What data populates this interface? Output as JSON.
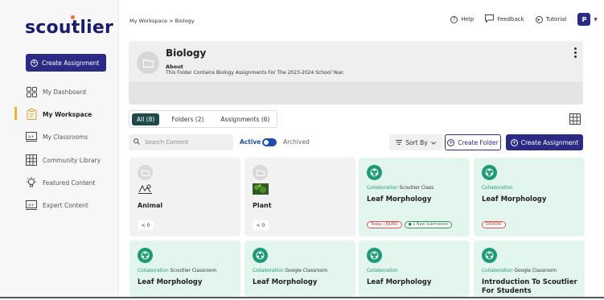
{
  "app": {
    "logo": "scoutlier",
    "create_assignment": "Create Assignment"
  },
  "sidebar": {
    "items": [
      {
        "label": "My Dashboard",
        "icon": "dashboard-icon"
      },
      {
        "label": "My Workspace",
        "icon": "clipboard-icon",
        "active": true
      },
      {
        "label": "My Classrooms",
        "icon": "classroom-icon"
      },
      {
        "label": "Community Library",
        "icon": "library-icon"
      },
      {
        "label": "Featured Content",
        "icon": "bulb-icon"
      },
      {
        "label": "Expert Content",
        "icon": "expert-icon"
      }
    ]
  },
  "header": {
    "breadcrumb": "My Workspace > Biology",
    "help": "Help",
    "feedback": "Feedback",
    "tutorial": "Tutorial",
    "avatar": "P"
  },
  "folder": {
    "title": "Biology",
    "about_label": "About",
    "description": "This Folder Contains Biology Assignments For The 2023-2024 School Year."
  },
  "tabs": [
    {
      "label": "All (8)",
      "selected": true
    },
    {
      "label": "Folders (2)"
    },
    {
      "label": "Assignments (6)"
    }
  ],
  "toolbar": {
    "search_placeholder": "Search Content",
    "active_label": "Active",
    "archived_label": "Archived",
    "sort_label": "Sort By",
    "create_folder": "Create Folder",
    "create_assignment": "Create Assignment"
  },
  "cards": [
    {
      "type": "folder",
      "title": "Animal",
      "share_count": "< 0"
    },
    {
      "type": "folder",
      "title": "Plant",
      "share_count": "< 0"
    },
    {
      "type": "assignment",
      "tag": "Collaboration",
      "source": "Scoutlier Class",
      "title": "Leaf Morphology",
      "pills": [
        {
          "text": "Today | EJURQ",
          "color": "red"
        },
        {
          "text": "● 1 New Submission",
          "color": "green"
        }
      ]
    },
    {
      "type": "assignment",
      "tag": "Collaboration",
      "source": "",
      "title": "Leaf Morphology",
      "pills": [
        {
          "text": "DE9IDW",
          "color": "red"
        }
      ]
    },
    {
      "type": "assignment",
      "tag": "Collaboration",
      "source": "Scoutlier Classroom",
      "title": "Leaf Morphology",
      "pills": []
    },
    {
      "type": "assignment",
      "tag": "Collaboration",
      "source": "Google Classroom",
      "title": "Leaf Morphology",
      "pills": []
    },
    {
      "type": "assignment",
      "tag": "Collaboration",
      "source": "",
      "title": "Leaf Morphology",
      "pills": []
    },
    {
      "type": "assignment",
      "tag": "Collaboration",
      "source": "Google Classroom",
      "title": "Introduction To Scoutlier For Students",
      "pills": []
    }
  ],
  "colors": {
    "brand": "#2b2b86",
    "accent_green": "#1f9a76",
    "active_tab": "#1f4a4a"
  }
}
